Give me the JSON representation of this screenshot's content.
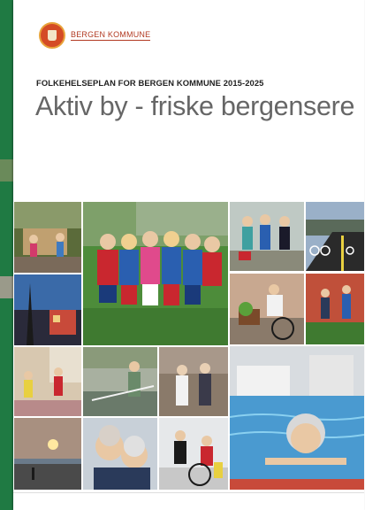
{
  "brand": {
    "name": "BERGEN KOMMUNE"
  },
  "cover": {
    "kicker": "FOLKEHELSEPLAN FOR BERGEN KOMMUNE 2015-2025",
    "title": "Aktiv by - friske bergensere"
  },
  "colors": {
    "brand_red": "#b23a22",
    "title_gray": "#666666",
    "left_green": "#1f7a43"
  }
}
